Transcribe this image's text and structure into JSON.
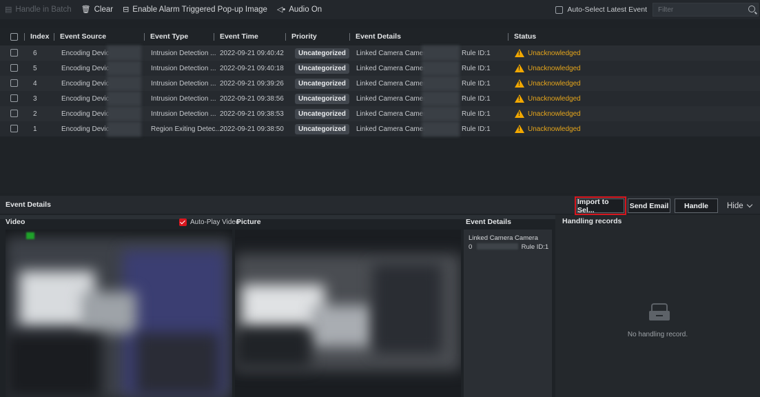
{
  "toolbar": {
    "handle_in_batch": "Handle in Batch",
    "clear": "Clear",
    "enable_popup": "Enable Alarm Triggered Pop-up Image",
    "audio_on": "Audio On",
    "auto_select": "Auto-Select Latest Event",
    "filter_placeholder": "Filter"
  },
  "table": {
    "headers": {
      "index": "Index",
      "event_source": "Event Source",
      "event_type": "Event Type",
      "event_time": "Event Time",
      "priority": "Priority",
      "event_details": "Event Details",
      "status": "Status"
    },
    "rows": [
      {
        "index": "6",
        "source": "Encoding Device:",
        "type": "Intrusion Detection ...",
        "time": "2022-09-21 09:40:42",
        "priority": "Uncategorized",
        "details": "Linked Camera Camera",
        "rule": "Rule ID:1",
        "status": "Unacknowledged"
      },
      {
        "index": "5",
        "source": "Encoding Device:",
        "type": "Intrusion Detection ...",
        "time": "2022-09-21 09:40:18",
        "priority": "Uncategorized",
        "details": "Linked Camera Camera",
        "rule": "Rule ID:1",
        "status": "Unacknowledged"
      },
      {
        "index": "4",
        "source": "Encoding Device:",
        "type": "Intrusion Detection ...",
        "time": "2022-09-21 09:39:26",
        "priority": "Uncategorized",
        "details": "Linked Camera Camera",
        "rule": "Rule ID:1",
        "status": "Unacknowledged"
      },
      {
        "index": "3",
        "source": "Encoding Device:",
        "type": "Intrusion Detection ...",
        "time": "2022-09-21 09:38:56",
        "priority": "Uncategorized",
        "details": "Linked Camera Camera",
        "rule": "Rule ID:1",
        "status": "Unacknowledged"
      },
      {
        "index": "2",
        "source": "Encoding Device:",
        "type": "Intrusion Detection ...",
        "time": "2022-09-21 09:38:53",
        "priority": "Uncategorized",
        "details": "Linked Camera Camera",
        "rule": "Rule ID:1",
        "status": "Unacknowledged"
      },
      {
        "index": "1",
        "source": "Encoding Device:",
        "type": "Region Exiting Detec...",
        "time": "2022-09-21 09:38:50",
        "priority": "Uncategorized",
        "details": "Linked Camera Camera",
        "rule": "Rule ID:1",
        "status": "Unacknowledged"
      }
    ]
  },
  "detail_bar": {
    "title": "Event Details",
    "import_btn": "Import to Sel...",
    "email_btn": "Send Email",
    "handle_btn": "Handle",
    "hide": "Hide"
  },
  "panels": {
    "video": "Video",
    "auto_play": "Auto-Play Video",
    "picture": "Picture",
    "event_details": "Event Details",
    "event_details_line1": "Linked Camera Camera",
    "event_details_line2_prefix": "0",
    "event_details_line2_rule": "Rule ID:1",
    "handling_records": "Handling records",
    "no_records": "No handling record."
  },
  "colors": {
    "background": "#1e2226",
    "warning": "#f2a800",
    "status_text": "#e5a51b",
    "highlight": "#d9161e"
  }
}
